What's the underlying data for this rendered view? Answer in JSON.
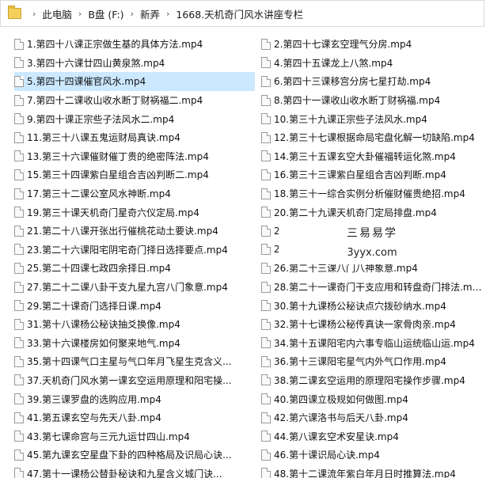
{
  "breadcrumb": [
    "此电脑",
    "B盘 (F:)",
    "新弄",
    "1668.天机奇门风水讲座专栏"
  ],
  "breadcrumb_separator": "›",
  "files_left": [
    "1.第四十八课正宗做生基的具体方法.mp4",
    "3.第四十六课廿四山黄泉煞.mp4",
    "5.第四十四课催官风水.mp4",
    "7.第四十二课收山收水断丁财祸福二.mp4",
    "9.第四十课正宗些子法风水二.mp4",
    "11.第三十八课五鬼运财局真诀.mp4",
    "13.第三十六课催财催丁贵的绝密阵法.mp4",
    "15.第三十四课紫白星组合吉凶判断二.mp4",
    "17.第三十二课公室风水神断.mp4",
    "19.第三十课天机奇门星奇六仪定局.mp4",
    "21.第二十八课开张出行催桃花动土要诀.mp4",
    "23.第二十六课阳宅阴宅奇门择日选择要点.mp4",
    "25.第二十四课七政四余择日.mp4",
    "27.第二十二课八卦干支九星九宫八门象意.mp4",
    "29.第二十课奇门选择日课.mp4",
    "31.第十八课杨公秘诀抽爻换像.mp4",
    "33.第十六课楼房如何聚来地气.mp4",
    "35.第十四课气口主星与气口年月飞星生克含义...",
    "37.天机奇门风水第一课玄空运用原理和阳宅操...",
    "39.第三课罗盘的选购应用.mp4",
    "41.第五课玄空与先天八卦.mp4",
    "43.第七课命宫与三元九运廿四山.mp4",
    "45.第九课玄空星盘下卦的四种格局及识局心诀...",
    "47.第十一课杨公替卦秘诀和九星含义城门诀..."
  ],
  "files_right": [
    "2.第四十七课玄空理气分房.mp4",
    "4.第四十五课龙上八煞.mp4",
    "6.第四十三课移宫分房七星打劫.mp4",
    "8.第四十一课收山收水断丁财祸福.mp4",
    "10.第三十九课正宗些子法风水.mp4",
    "12.第三十七课根据命局宅盘化解一切缺陷.mp4",
    "14.第三十五课玄空大卦催福转运化煞.mp4",
    "16.第三十三课紫白星组合吉凶判断.mp4",
    "18.第三十一综合实例分析催财催贵绝招.mp4",
    "20.第二十九课天机奇门定局排盘.mp4",
    "22",
    "24",
    "26.第二十三课八门八神象意.mp4",
    "28.第二十一课奇门干支应用和转盘奇门排法.mp...",
    "30.第十九课杨公秘诀点穴拨砂纳水.mp4",
    "32.第十七课杨公秘传真诀一家骨肉亲.mp4",
    "34.第十五课阳宅内六事专临山运统临山运.mp4",
    "36.第十三课阳宅星气内外气口作用.mp4",
    "38.第二课玄空运用的原理阳宅操作步骤.mp4",
    "40.第四课立极规如何做图.mp4",
    "42.第六课洛书与后天八卦.mp4",
    "44.第八课玄空术安星诀.mp4",
    "46.第十课识局心诀.mp4",
    "48.第十二课流年紫白年月日时推算法.mp4"
  ],
  "selected_item": "5.第四十四课催官风水.mp4",
  "watermark": {
    "title": "三易易学",
    "url": "3yyx.com"
  },
  "colors": {
    "selection": "#cce8ff",
    "border": "#d9d9d9"
  }
}
